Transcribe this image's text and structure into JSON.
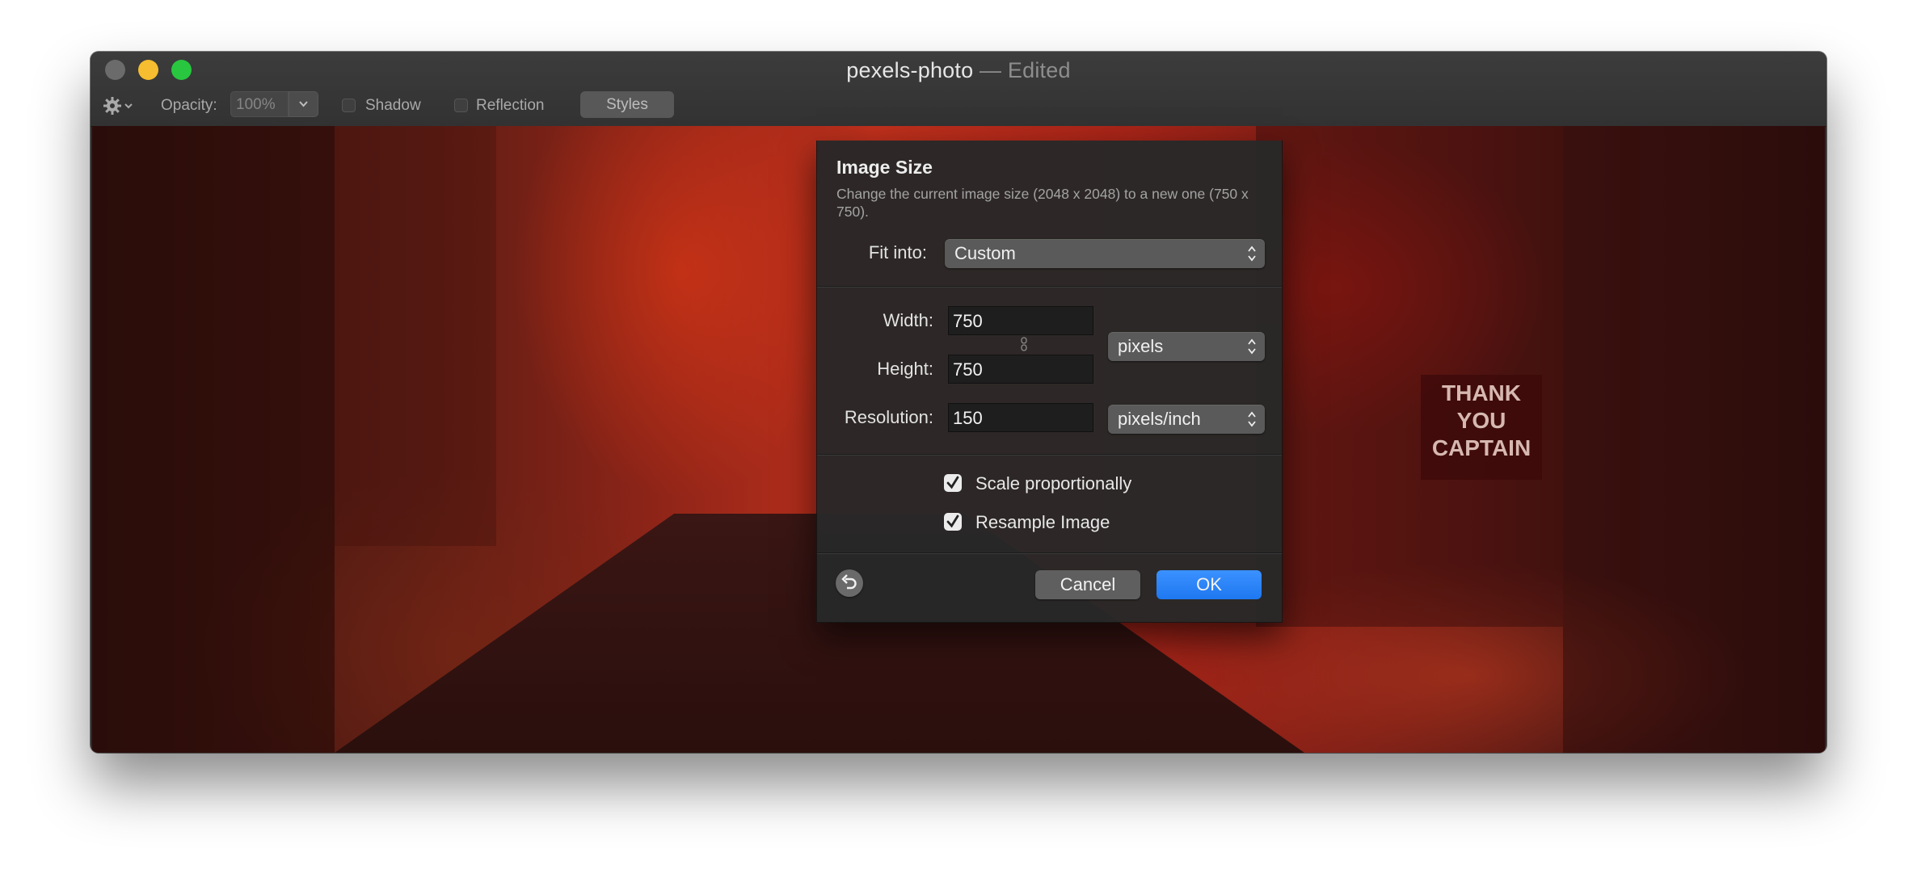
{
  "window": {
    "title": "pexels-photo",
    "title_separator": " — ",
    "title_status": "Edited"
  },
  "toolbar": {
    "opacity_label": "Opacity:",
    "opacity_value": "100%",
    "shadow_label": "Shadow",
    "shadow_checked": false,
    "reflection_label": "Reflection",
    "reflection_checked": false,
    "styles_label": "Styles"
  },
  "photo": {
    "sign_text": "THANK YOU CAPTAIN"
  },
  "dialog": {
    "title": "Image Size",
    "description": "Change the current image size (2048 x 2048) to a new one (750 x 750).",
    "fit_into_label": "Fit into:",
    "fit_into_value": "Custom",
    "width_label": "Width:",
    "width_value": "750",
    "height_label": "Height:",
    "height_value": "750",
    "size_unit": "pixels",
    "resolution_label": "Resolution:",
    "resolution_value": "150",
    "resolution_unit": "pixels/inch",
    "scale_label": "Scale proportionally",
    "scale_checked": true,
    "resample_label": "Resample Image",
    "resample_checked": true,
    "cancel_label": "Cancel",
    "ok_label": "OK"
  },
  "colors": {
    "accent": "#1e78f0",
    "close": "#6b6b6b",
    "minimize": "#f5bd2f",
    "maximize": "#28c73f"
  }
}
